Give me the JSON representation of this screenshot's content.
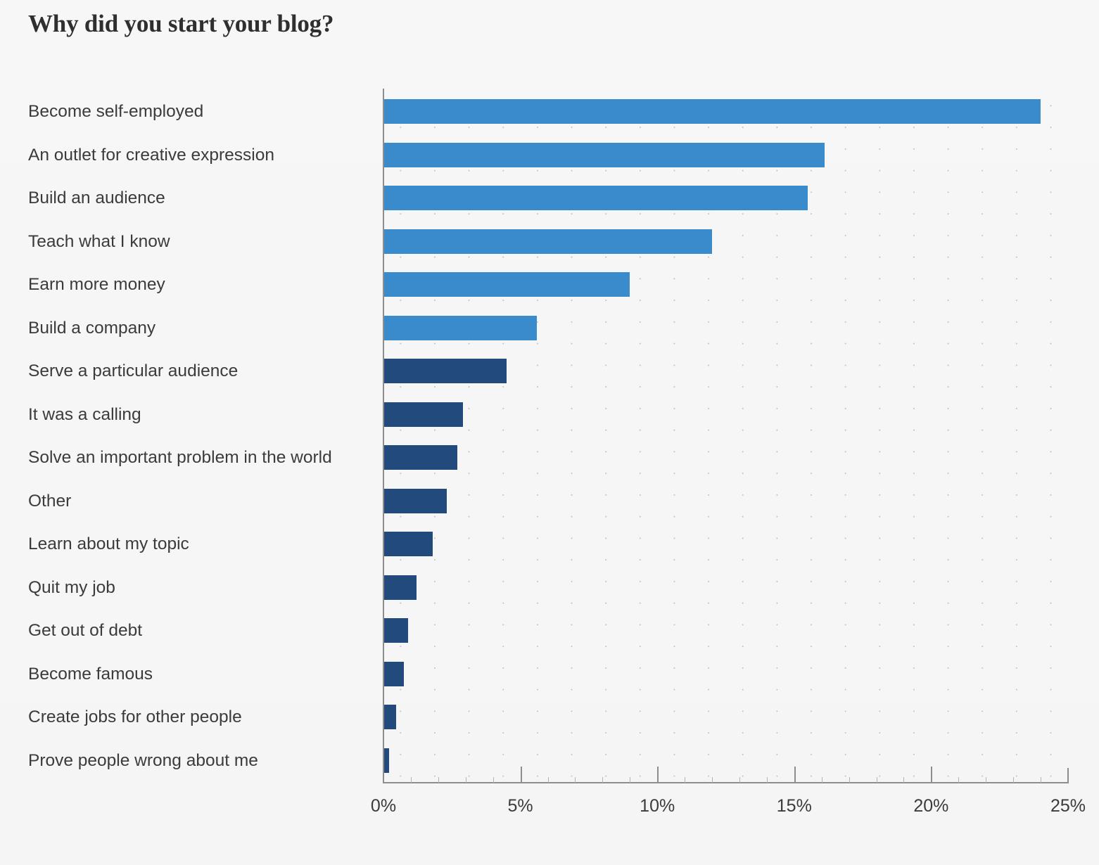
{
  "chart_data": {
    "type": "bar",
    "orientation": "horizontal",
    "title": "Why did you start your blog?",
    "xlabel": "",
    "ylabel": "",
    "xlim": [
      0,
      25
    ],
    "x_tick_labels": [
      "0%",
      "5%",
      "10%",
      "15%",
      "20%",
      "25%"
    ],
    "x_tick_values": [
      0,
      5,
      10,
      15,
      20,
      25
    ],
    "x_minor_tick_step": 1,
    "grid": "dotted",
    "legend": "none",
    "value_suffix": "%",
    "colors": {
      "light_blue": "#3a8bcb",
      "dark_blue": "#234a7c",
      "background": "#f6f6f6",
      "axis": "#8d8d8d",
      "text": "#3b3b3b",
      "title": "#2f2f2f",
      "grid_dot": "#b9b9b9"
    },
    "categories": [
      "Become self-employed",
      "An outlet for creative expression",
      "Build an audience",
      "Teach what I know",
      "Earn more money",
      "Build a company",
      "Serve a particular audience",
      "It was a calling",
      "Solve an important problem in the world",
      "Other",
      "Learn about my topic",
      "Quit my job",
      "Get out of debt",
      "Become famous",
      "Create jobs for other people",
      "Prove people wrong about me"
    ],
    "values": [
      24.0,
      16.1,
      15.5,
      12.0,
      9.0,
      5.6,
      4.5,
      2.9,
      2.7,
      2.3,
      1.8,
      1.2,
      0.9,
      0.75,
      0.45,
      0.2
    ],
    "bar_colors": [
      "light_blue",
      "light_blue",
      "light_blue",
      "light_blue",
      "light_blue",
      "light_blue",
      "dark_blue",
      "dark_blue",
      "dark_blue",
      "dark_blue",
      "dark_blue",
      "dark_blue",
      "dark_blue",
      "dark_blue",
      "dark_blue",
      "dark_blue"
    ]
  }
}
